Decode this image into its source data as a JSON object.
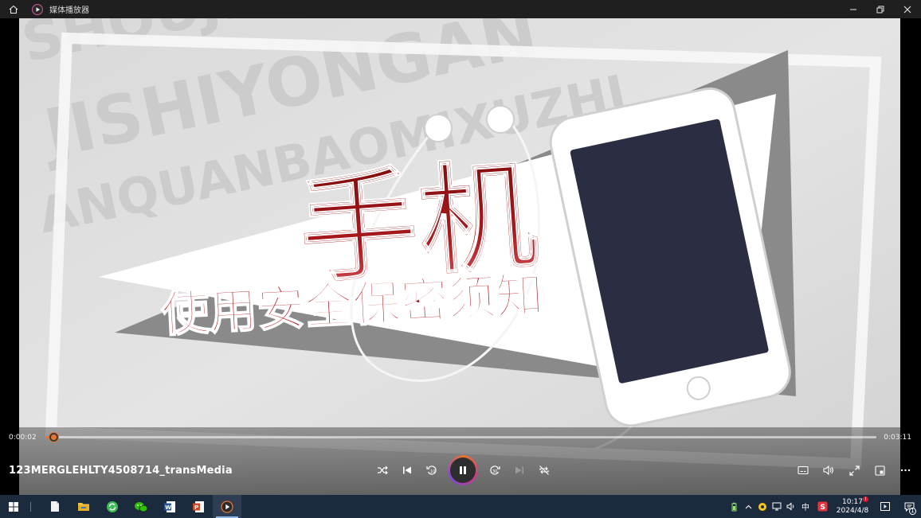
{
  "titlebar": {
    "app_title": "媒体播放器",
    "icons": [
      "home-icon",
      "app-play-icon",
      "minimize-icon",
      "restore-icon",
      "close-icon"
    ]
  },
  "video": {
    "headline": "手机",
    "subtitle": "使用安全保密须知",
    "watermark_lines": [
      "SHOUJI",
      "JISHIYONGAN",
      "ANQUANBAOMIXUZHI"
    ]
  },
  "player": {
    "current_time": "0:00:02",
    "duration": "0:03:11",
    "progress_fraction": 0.01,
    "filename": "123MERGLEHLTY4508714_transMedia",
    "center_controls": [
      "shuffle-icon",
      "previous-icon",
      "rewind-10-icon",
      "pause-icon",
      "forward-30-icon",
      "next-icon",
      "repeat-off-icon"
    ],
    "right_controls": [
      "subtitles-icon",
      "volume-icon",
      "fullscreen-icon",
      "mini-view-icon",
      "more-icon"
    ],
    "accent": "#e6752e"
  },
  "taskbar": {
    "apps": [
      "file-icon",
      "file-explorer-icon",
      "refresh-app-icon",
      "wechat-icon",
      "word-icon",
      "powerpoint-icon",
      "media-player-icon"
    ],
    "tray": {
      "ime_label": "中",
      "time": "10:17",
      "date": "2024/4/8",
      "notification_count": "1",
      "clock_badge": "!"
    }
  }
}
